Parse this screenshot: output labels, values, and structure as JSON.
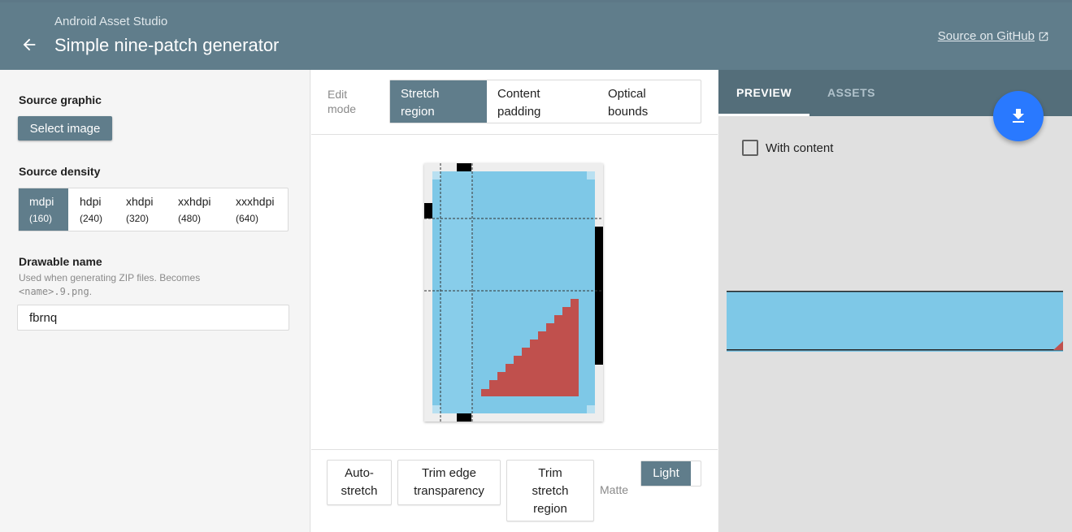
{
  "header": {
    "app_name": "Android Asset Studio",
    "title": "Simple nine-patch generator",
    "github_link": "Source on GitHub"
  },
  "left": {
    "source_graphic_label": "Source graphic",
    "select_image_button": "Select image",
    "source_density_label": "Source density",
    "densities": [
      {
        "name": "mdpi",
        "value": "(160)",
        "selected": true
      },
      {
        "name": "hdpi",
        "value": "(240)",
        "selected": false
      },
      {
        "name": "xhdpi",
        "value": "(320)",
        "selected": false
      },
      {
        "name": "xxhdpi",
        "value": "(480)",
        "selected": false
      },
      {
        "name": "xxxhdpi",
        "value": "(640)",
        "selected": false
      }
    ],
    "drawable_name_label": "Drawable name",
    "drawable_help_prefix": "Used when generating ZIP files. Becomes",
    "drawable_help_code": "<name>.9.png",
    "drawable_help_suffix": ".",
    "drawable_name_value": "fbrnq"
  },
  "center": {
    "edit_mode_label_line1": "Edit",
    "edit_mode_label_line2": "mode",
    "modes": [
      {
        "line1": "Stretch",
        "line2": "region",
        "selected": true
      },
      {
        "line1": "Content",
        "line2": "padding",
        "selected": false
      },
      {
        "line1": "Optical",
        "line2": "bounds",
        "selected": false
      }
    ],
    "auto_stretch": {
      "line1": "Auto-",
      "line2": "stretch"
    },
    "trim_edge": {
      "line1": "Trim edge",
      "line2": "transparency"
    },
    "trim_stretch": {
      "line1": "Trim",
      "line2": "stretch",
      "line3": "region"
    },
    "matte_label": "Matte",
    "matte_option": "Light"
  },
  "right": {
    "tab_preview": "PREVIEW",
    "tab_assets": "ASSETS",
    "with_content_label": "With content",
    "with_content_checked": false
  },
  "colors": {
    "header_bg": "#607d8b",
    "tab_bar_bg": "#546e7a",
    "fab": "#2979ff",
    "image_fill": "#7ec8e7",
    "triangle": "#c0504d"
  },
  "icons": {
    "back": "arrow-left-icon",
    "external": "external-link-icon",
    "download": "download-icon"
  }
}
